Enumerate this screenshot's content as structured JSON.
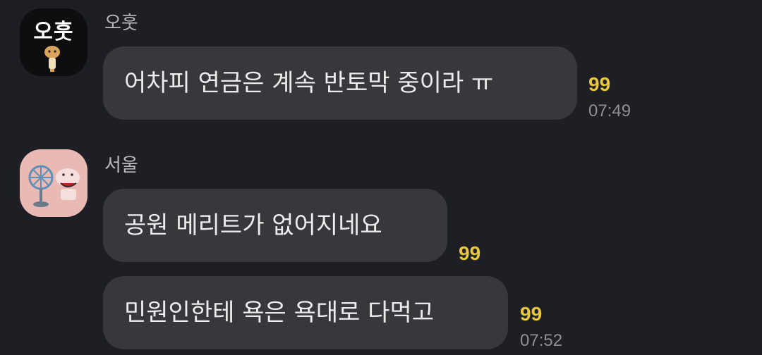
{
  "messages": [
    {
      "sender": "오훗",
      "avatar_text": "오훗",
      "text": "어차피 연금은 계속 반토막 중이라 ㅠ",
      "unread": "99",
      "time": "07:49"
    },
    {
      "sender": "서울",
      "text": "공원 메리트가 없어지네요",
      "unread": "99"
    },
    {
      "text": "민원인한테 욕은 욕대로 다먹고",
      "unread": "99",
      "time": "07:52"
    }
  ],
  "colors": {
    "background": "#1e1f24",
    "bubble": "#37373c",
    "unread": "#e9c63a",
    "time": "#8f8f95",
    "avatar_2": "#e9b9b3"
  },
  "icons": {
    "avatar_1": "character-profile-icon",
    "avatar_2": "fan-character-profile-icon"
  }
}
